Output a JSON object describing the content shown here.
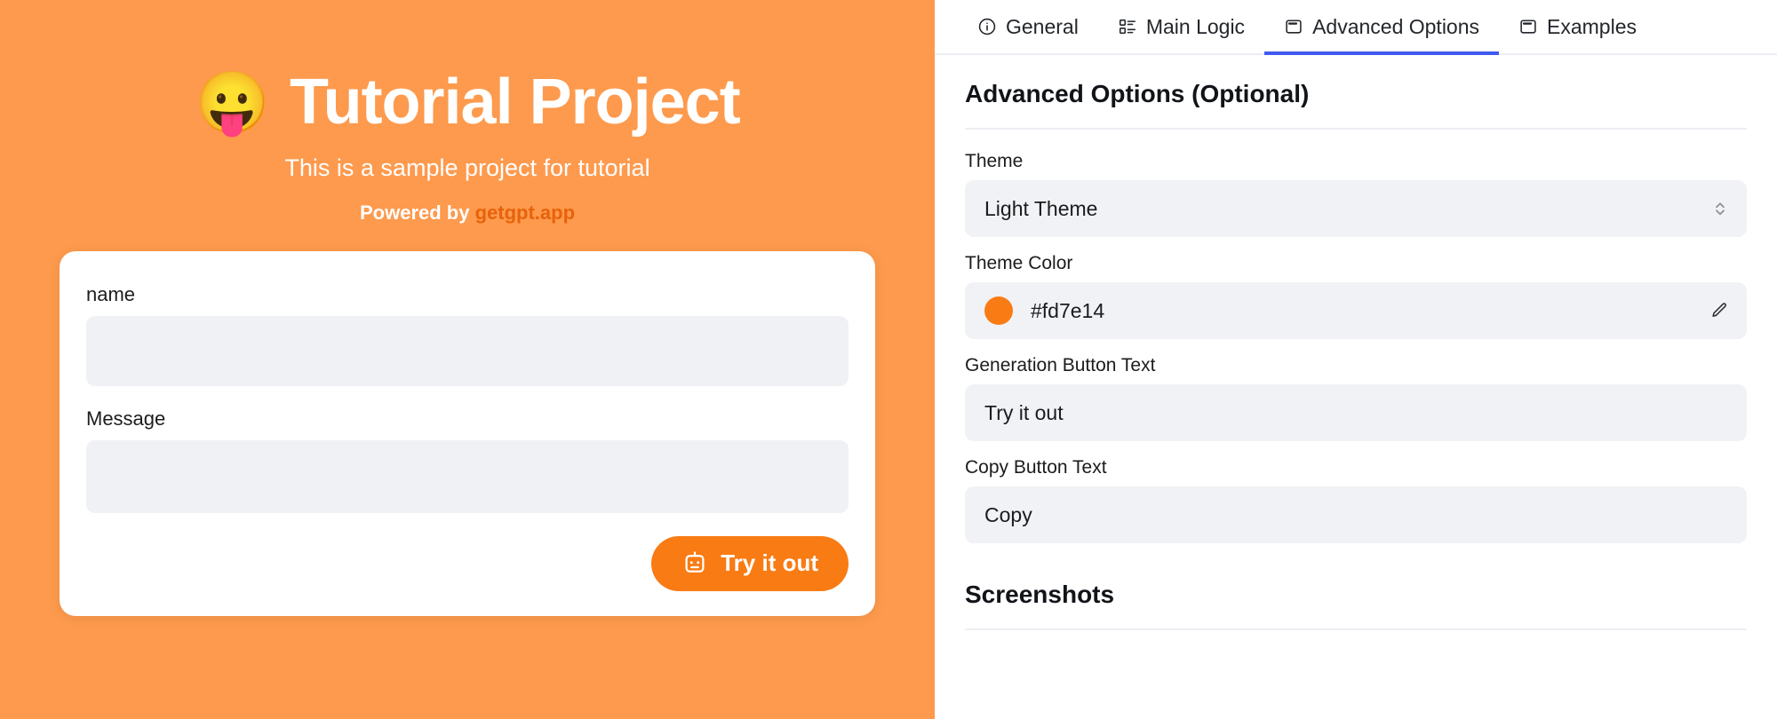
{
  "preview": {
    "emoji": "😛",
    "emoji_name": "face-with-tongue-emoji",
    "title": "Tutorial Project",
    "subtitle": "This is a sample project for tutorial",
    "powered_prefix": "Powered by ",
    "powered_link": "getgpt.app",
    "background_color": "#fd9a4d",
    "accent_color": "#f97b14",
    "form": {
      "name_label": "name",
      "name_value": "",
      "message_label": "Message",
      "message_value": "",
      "submit_label": "Try it out"
    }
  },
  "settings": {
    "tabs": [
      {
        "label": "General",
        "icon": "info-circle-icon",
        "active": false
      },
      {
        "label": "Main Logic",
        "icon": "list-layout-icon",
        "active": false
      },
      {
        "label": "Advanced Options",
        "icon": "window-icon",
        "active": true
      },
      {
        "label": "Examples",
        "icon": "window-icon",
        "active": false
      }
    ],
    "active_tab_underline_color": "#4059f0",
    "section_title": "Advanced Options (Optional)",
    "fields": [
      {
        "label": "Theme",
        "value": "Light Theme",
        "control": "select",
        "trailing_icon": "chevron-up-down-icon"
      },
      {
        "label": "Theme Color",
        "value": "#fd7e14",
        "control": "color",
        "swatch_color": "#f97b14",
        "trailing_icon": "pencil-icon"
      },
      {
        "label": "Generation Button Text",
        "value": "Try it out",
        "control": "text",
        "trailing_icon": ""
      },
      {
        "label": "Copy Button Text",
        "value": "Copy",
        "control": "text",
        "trailing_icon": ""
      }
    ],
    "screenshots_title": "Screenshots"
  }
}
